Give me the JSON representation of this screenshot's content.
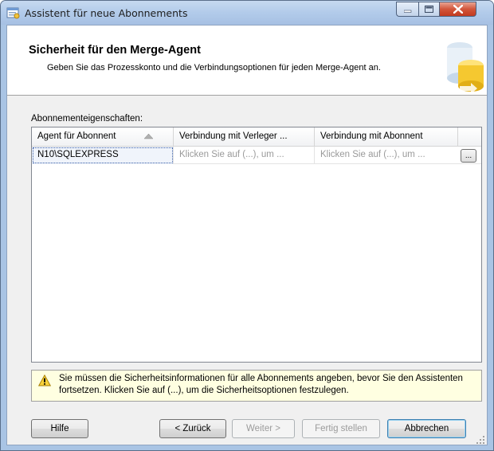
{
  "window": {
    "title": "Assistent für neue Abonnements"
  },
  "header": {
    "title": "Sicherheit für den Merge-Agent",
    "description": "Geben Sie das Prozesskonto und die Verbindungsoptionen für jeden Merge-Agent an."
  },
  "grid": {
    "label": "Abonnementeigenschaften:",
    "columns": [
      "Agent für Abonnent",
      "Verbindung mit Verleger ...",
      "Verbindung mit Abonnent"
    ],
    "rows": [
      {
        "agent": "N10\\SQLEXPRESS",
        "publisher": "Klicken Sie auf (...), um ...",
        "subscriber": "Klicken Sie auf (...), um ...",
        "ellipsis": "..."
      }
    ]
  },
  "warning": {
    "text": "Sie müssen die Sicherheitsinformationen für alle Abonnements angeben, bevor Sie den Assistenten fortsetzen. Klicken Sie auf (...), um die Sicherheitsoptionen festzulegen."
  },
  "buttons": {
    "help": "Hilfe",
    "back": "< Zurück",
    "next": "Weiter >",
    "finish": "Fertig stellen",
    "cancel": "Abbrechen"
  }
}
